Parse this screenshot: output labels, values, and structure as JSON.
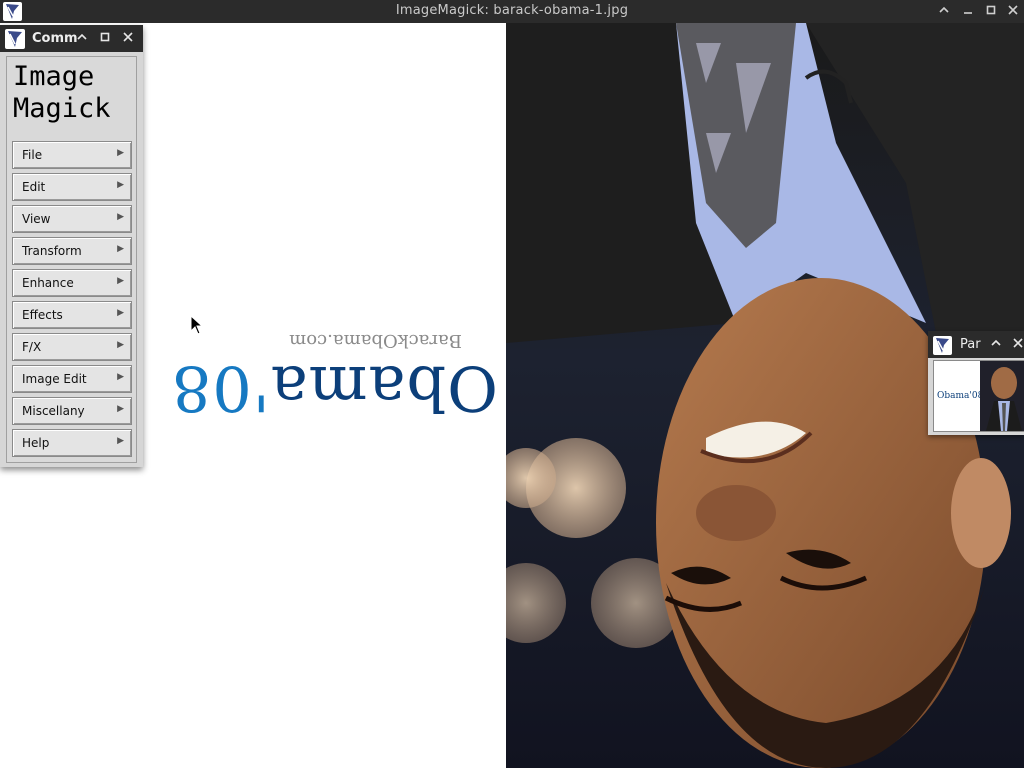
{
  "window": {
    "title": "ImageMagick: barack-obama-1.jpg",
    "controls": [
      "^",
      "_",
      "□",
      "X"
    ]
  },
  "commands_panel": {
    "title": "Comm",
    "brand_line1": "Image",
    "brand_line2": "Magick",
    "items": [
      {
        "label": "File"
      },
      {
        "label": "Edit"
      },
      {
        "label": "View"
      },
      {
        "label": "Transform"
      },
      {
        "label": "Enhance"
      },
      {
        "label": "Effects"
      },
      {
        "label": "F/X"
      },
      {
        "label": "Image Edit"
      },
      {
        "label": "Miscellany"
      },
      {
        "label": "Help"
      }
    ],
    "submenu_indicator": "▶"
  },
  "pan_window": {
    "title": "Par",
    "thumb_logo": "Obama'08"
  },
  "image": {
    "logo_site": "BarackObama.com",
    "logo_word": "Obama",
    "logo_year": "'08",
    "rotation": "180deg"
  },
  "colors": {
    "titlebar": "#2b2b2b",
    "panel": "#d6d6d6",
    "logo_dark": "#0c3f7a",
    "logo_light": "#1679c2"
  }
}
